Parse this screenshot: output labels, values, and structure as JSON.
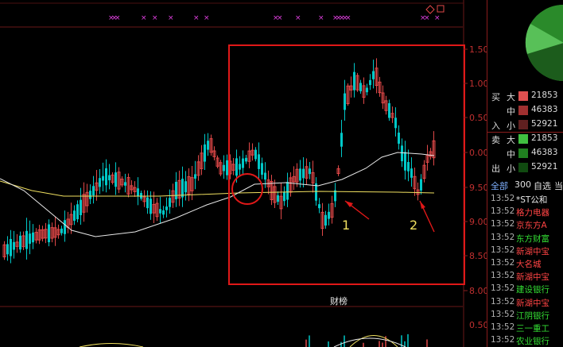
{
  "price_axis": [
    "1.50",
    "1.00",
    "0.50",
    "0.00",
    "9.50",
    "9.00",
    "8.50",
    "8.00"
  ],
  "sub_axis": [
    "0.50"
  ],
  "section_label": "财榜",
  "annotations": {
    "label_1": "1",
    "label_2": "2"
  },
  "colors": {
    "up": "#e04848",
    "down": "#00c8c8",
    "ma_long": "#f0e060",
    "ma_short": "#e8e8e8",
    "highlight": "#e01818",
    "marker": "#e040e0"
  },
  "order_book": {
    "buy_label": "买",
    "buy_label2": "入",
    "sell_label": "卖",
    "sell_label2": "出",
    "rows": [
      {
        "size": "大",
        "value": "21853",
        "color": "#e05050"
      },
      {
        "size": "中",
        "value": "46383",
        "color": "#a03030"
      },
      {
        "size": "小",
        "value": "52921",
        "color": "#602020"
      },
      {
        "size": "大",
        "value": "21853",
        "color": "#40c040"
      },
      {
        "size": "中",
        "value": "46383",
        "color": "#208020"
      },
      {
        "size": "小",
        "value": "52921",
        "color": "#104a10"
      }
    ]
  },
  "controls": {
    "all": "全部",
    "count": "300",
    "watch": "自选",
    "current": "当"
  },
  "tape": [
    {
      "time": "13:52",
      "name": "*ST公和",
      "color": "#e8e8e8"
    },
    {
      "time": "13:52",
      "name": "格力电器",
      "color": "#ff4444"
    },
    {
      "time": "13:52",
      "name": "京东方A",
      "color": "#ff4444"
    },
    {
      "time": "13:52",
      "name": "东方财富",
      "color": "#33dd33"
    },
    {
      "time": "13:52",
      "name": "新湖中宝",
      "color": "#ff4444"
    },
    {
      "time": "13:52",
      "name": "大名城",
      "color": "#ff4444"
    },
    {
      "time": "13:52",
      "name": "新湖中宝",
      "color": "#ff4444"
    },
    {
      "time": "13:52",
      "name": "建设银行",
      "color": "#33dd33"
    },
    {
      "time": "13:52",
      "name": "新湖中宝",
      "color": "#ff4444"
    },
    {
      "time": "13:52",
      "name": "江阴银行",
      "color": "#33dd33"
    },
    {
      "time": "13:52",
      "name": "三一重工",
      "color": "#33dd33"
    },
    {
      "time": "13:52",
      "name": "农业银行",
      "color": "#33dd33"
    }
  ],
  "icons": {
    "diamond": "diamond-icon",
    "square": "square-icon"
  }
}
